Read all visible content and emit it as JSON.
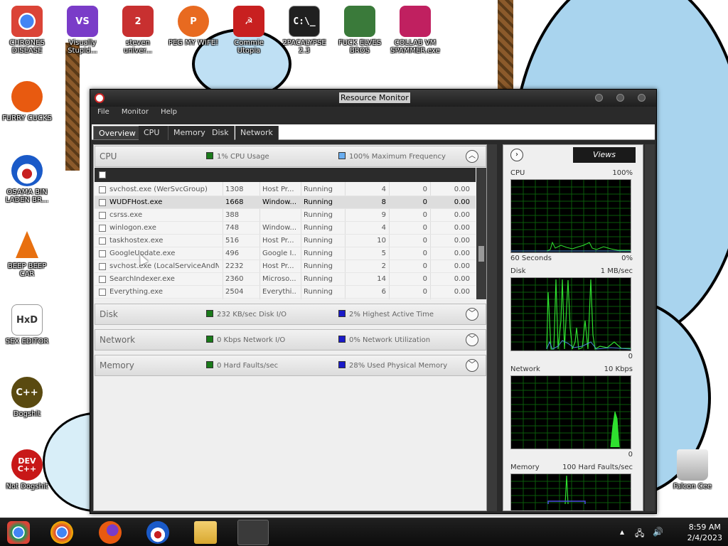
{
  "window": {
    "title": "Resource Monitor",
    "menu": [
      "File",
      "Monitor",
      "Help"
    ],
    "tabs": [
      "Overview",
      "CPU",
      "Memory",
      "Disk",
      "Network"
    ]
  },
  "sections": {
    "cpu": {
      "name": "CPU",
      "metric1": "1% CPU Usage",
      "metric2": "100% Maximum Frequency",
      "color1": "#1a7a1a",
      "color2": "#6aaef0"
    },
    "disk": {
      "name": "Disk",
      "metric1": "232 KB/sec Disk I/O",
      "metric2": "2% Highest Active Time",
      "color1": "#1a7a1a",
      "color2": "#1a1ac8"
    },
    "network": {
      "name": "Network",
      "metric1": "0 Kbps Network I/O",
      "metric2": "0% Network Utilization",
      "color1": "#1a7a1a",
      "color2": "#1a1ac8"
    },
    "memory": {
      "name": "Memory",
      "metric1": "0 Hard Faults/sec",
      "metric2": "28% Used Physical Memory",
      "color1": "#1a7a1a",
      "color2": "#1a1ac8"
    }
  },
  "processes": [
    {
      "name": "svchost.exe (WerSvcGroup)",
      "pid": "1308",
      "desc": "Host Pr...",
      "status": "Running",
      "threads": "4",
      "cpu": "0",
      "avg": "0.00"
    },
    {
      "name": "WUDFHost.exe",
      "pid": "1668",
      "desc": "Window...",
      "status": "Running",
      "threads": "8",
      "cpu": "0",
      "avg": "0.00"
    },
    {
      "name": "csrss.exe",
      "pid": "388",
      "desc": "",
      "status": "Running",
      "threads": "9",
      "cpu": "0",
      "avg": "0.00"
    },
    {
      "name": "winlogon.exe",
      "pid": "748",
      "desc": "Window...",
      "status": "Running",
      "threads": "4",
      "cpu": "0",
      "avg": "0.00"
    },
    {
      "name": "taskhostex.exe",
      "pid": "516",
      "desc": "Host Pr...",
      "status": "Running",
      "threads": "10",
      "cpu": "0",
      "avg": "0.00"
    },
    {
      "name": "GoogleUpdate.exe",
      "pid": "496",
      "desc": "Google I...",
      "status": "Running",
      "threads": "5",
      "cpu": "0",
      "avg": "0.00"
    },
    {
      "name": "svchost.exe (LocalServiceAndN...",
      "pid": "2232",
      "desc": "Host Pr...",
      "status": "Running",
      "threads": "2",
      "cpu": "0",
      "avg": "0.00"
    },
    {
      "name": "SearchIndexer.exe",
      "pid": "2360",
      "desc": "Microso...",
      "status": "Running",
      "threads": "14",
      "cpu": "0",
      "avg": "0.00"
    },
    {
      "name": "Everything.exe",
      "pid": "2504",
      "desc": "Everythi...",
      "status": "Running",
      "threads": "6",
      "cpu": "0",
      "avg": "0.00"
    }
  ],
  "graphs": {
    "views_label": "Views",
    "cpu": {
      "label": "CPU",
      "max": "100%",
      "bottom_left": "60 Seconds",
      "bottom_right": "0%"
    },
    "disk": {
      "label": "Disk",
      "max": "1 MB/sec",
      "bottom_right": "0"
    },
    "network": {
      "label": "Network",
      "max": "10 Kbps",
      "bottom_right": "0"
    },
    "memory": {
      "label": "Memory",
      "max": "100 Hard Faults/sec"
    }
  },
  "desktop_icons": [
    {
      "label": "CHRONES DISEASE",
      "color": "#e8b030"
    },
    {
      "label": "Visually Stupid...",
      "color": "#7a3cc8"
    },
    {
      "label": "steven univer...",
      "color": "#c83030"
    },
    {
      "label": "PEG MY WIFE!",
      "color": "#e86a20"
    },
    {
      "label": "Commie Utopia",
      "color": "#c82020"
    },
    {
      "label": "2PACALYPSE 2.3",
      "color": "#202020"
    },
    {
      "label": "FUCK ELVES BROS",
      "color": "#3a7a3a"
    },
    {
      "label": "COLLAB VM SPAMMER.exe",
      "color": "#c02060"
    },
    {
      "label": "FURRY CUCKS",
      "color": "#e85a10"
    },
    {
      "label": "OSAMA BIN LADEN BR...",
      "color": "#1a5ac8"
    },
    {
      "label": "BEEP BEEP CAR",
      "color": "#e87010"
    },
    {
      "label": "SEX EDITOR",
      "color": "#9a9a3a"
    },
    {
      "label": "Dogshit",
      "color": "#5a4a10"
    },
    {
      "label": "Not Dogshit",
      "color": "#c81818"
    },
    {
      "label": "Falcon Cee",
      "color": "#bbbbbb"
    }
  ],
  "clock": {
    "time": "8:59 AM",
    "date": "2/4/2023"
  }
}
